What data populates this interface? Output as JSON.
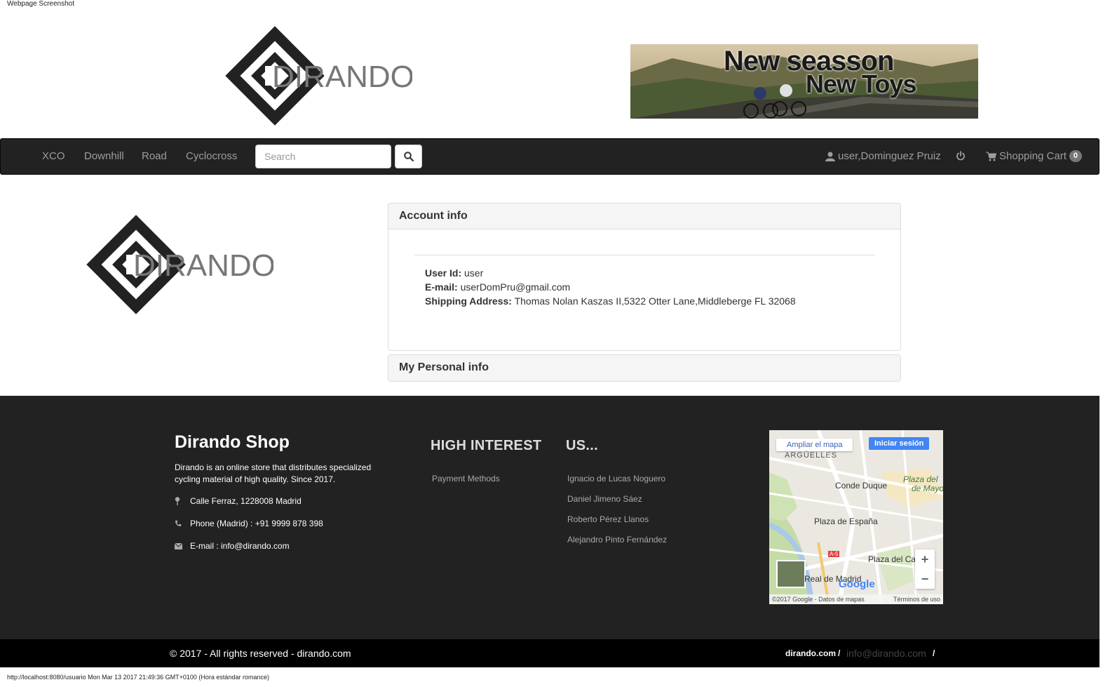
{
  "caption": "Webpage Screenshot",
  "brand": {
    "logo_text": "DIRANDO"
  },
  "banner": {
    "line1": "New seasson",
    "line2": "New Toys"
  },
  "navbar": {
    "items": [
      "XCO",
      "Downhill",
      "Road",
      "Cyclocross"
    ],
    "search_placeholder": "Search",
    "search_icon": "search-icon",
    "user_label": "user,Dominguez Pruiz",
    "power_icon": "power-icon",
    "cart_label": "Shopping Cart",
    "cart_count": "0"
  },
  "account": {
    "heading": "Account info",
    "user_id_label": "User Id:",
    "user_id": "user",
    "email_label": "E-mail:",
    "email": "userDomPru@gmail.com",
    "address_label": "Shipping Address:",
    "address": "Thomas Nolan Kaszas II,5322 Otter Lane,Middleberge FL 32068"
  },
  "personal": {
    "heading": "My Personal info"
  },
  "footer": {
    "title": "Dirando Shop",
    "description": "Dirando is an online store that distributes specialized cycling material of high quality. Since 2017.",
    "address": "Calle Ferraz, 1228008 Madrid",
    "phone": "Phone (Madrid) : +91 9999 878 398",
    "email": "E-mail : info@dirando.com",
    "high_interest_heading": "HIGH INTEREST",
    "high_interest_links": [
      "Payment Methods"
    ],
    "us_heading": "US...",
    "us_links": [
      "Ignacio de Lucas Noguero",
      "Daniel Jimeno Sáez",
      "Roberto Pérez Llanos",
      "Alejandro Pinto Fernández"
    ]
  },
  "map": {
    "ampliar": "Ampliar el mapa",
    "iniciar": "Iniciar sesión",
    "labels": [
      "ARGÜELLES",
      "Conde Duque",
      "Plaza del",
      "de Mayo",
      "Plaza de España",
      "Plaza del Ca",
      "Real de Madrid",
      "A-5"
    ],
    "google": "Google",
    "attribution": "©2017 Google - Datos de mapas",
    "terms": "Términos de uso"
  },
  "bottom": {
    "copyright": "© 2017 - All rights reserved - dirando.com",
    "site": "dirando.com",
    "sep": "/",
    "mail": "info@dirando.com"
  },
  "status_bar": "http://localhost:8080/usuario Mon Mar 13 2017 21:49:36 GMT+0100 (Hora estándar romance)",
  "colors": {
    "navbar": "#222222",
    "footer": "#222222",
    "bottom_bar": "#000000",
    "badge": "#777777"
  }
}
